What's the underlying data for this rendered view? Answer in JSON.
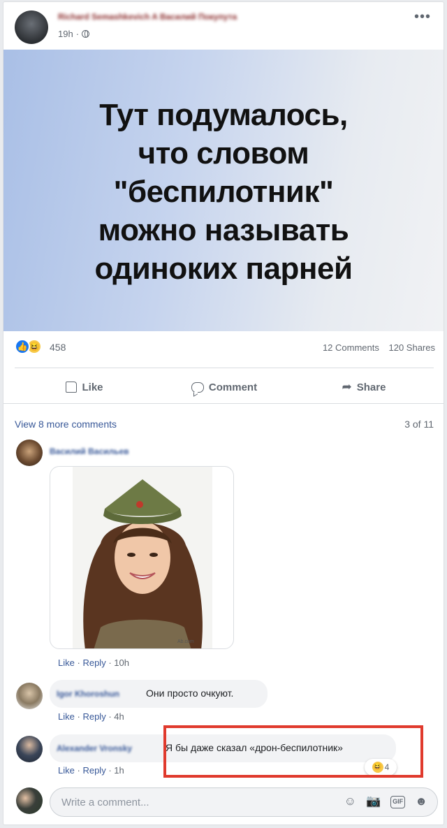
{
  "post": {
    "author": "Richard Semashkevich A Василий Покупута",
    "time": "19h",
    "meta_sep": "·",
    "meme_text": "Тут подумалось,\nчто словом\n\"беспилотник\"\nможно называть\nодиноких парней",
    "reactions": {
      "types": [
        "like-icon",
        "haha-icon"
      ],
      "count": "458"
    },
    "comments_count": "12 Comments",
    "shares_count": "120 Shares",
    "actions": {
      "like": "Like",
      "comment": "Comment",
      "share": "Share"
    }
  },
  "comments_section": {
    "view_more": "View 8 more comments",
    "page_count": "3 of 11",
    "comments": [
      {
        "author": "Василий Васильев",
        "text": "",
        "has_image": true,
        "actions": {
          "like": "Like",
          "reply": "Reply",
          "time": "10h",
          "sep": "·"
        }
      },
      {
        "author": "Igor Khoroshun",
        "text": "Они просто очкуют.",
        "actions": {
          "like": "Like",
          "reply": "Reply",
          "time": "4h",
          "sep": "·"
        }
      },
      {
        "author": "Alexander Vronsky",
        "text": "Я бы даже сказал «дрон-беспилотник»",
        "reaction_count": "4",
        "actions": {
          "like": "Like",
          "reply": "Reply",
          "time": "1h",
          "sep": "·"
        }
      }
    ],
    "write_placeholder": "Write a comment...",
    "write_icons": [
      "smiley-icon",
      "camera-icon",
      "gif-icon",
      "sticker-icon"
    ],
    "gif_label": "GIF"
  },
  "colors": {
    "link": "#385898",
    "secondary": "#606770",
    "highlight": "#e03a2d",
    "like_blue": "#1877f2",
    "haha_yellow": "#f7c948"
  }
}
